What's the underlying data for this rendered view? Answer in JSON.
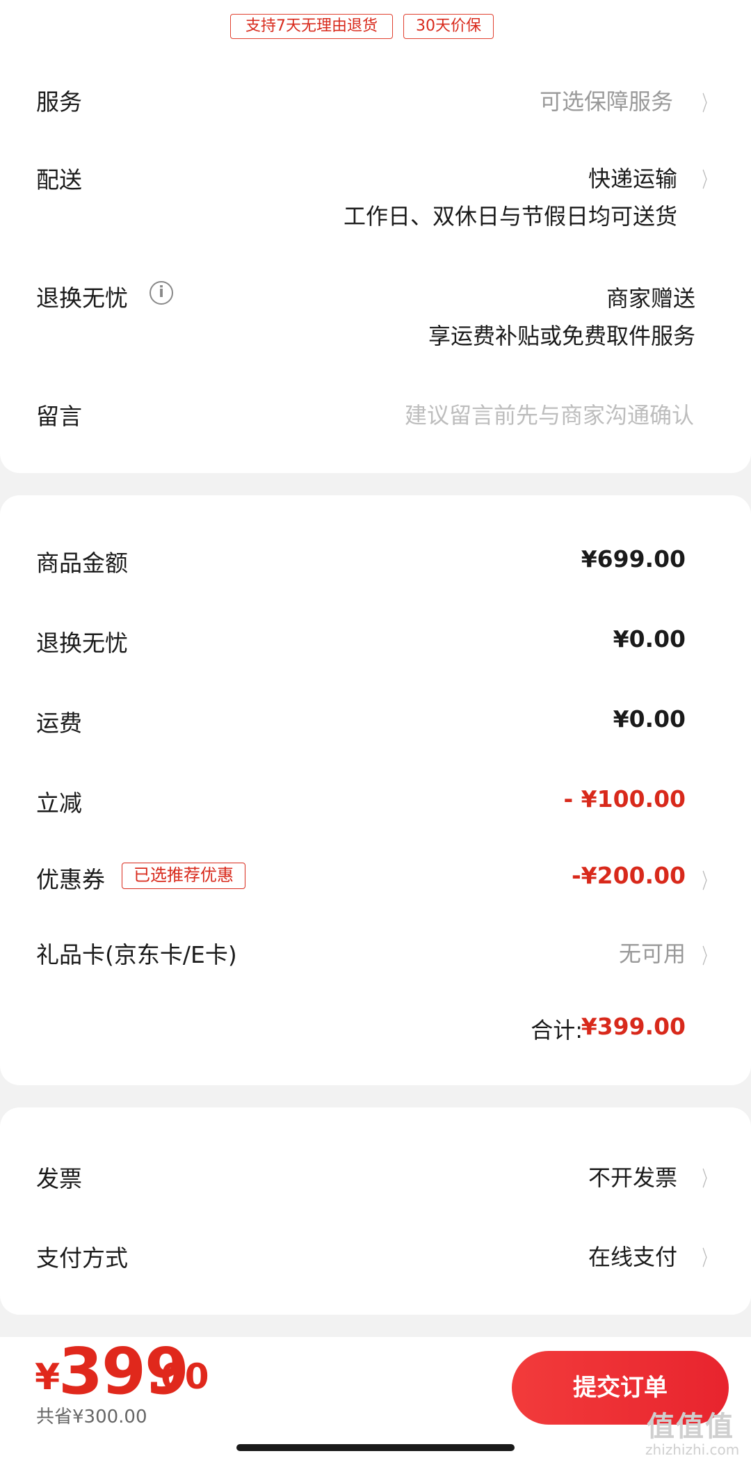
{
  "tags": {
    "return": "支持7天无理由退货",
    "price_protect": "30天价保"
  },
  "service": {
    "label": "服务",
    "value": "可选保障服务"
  },
  "delivery": {
    "label": "配送",
    "value": "快递运输",
    "sub": "工作日、双休日与节假日均可送货"
  },
  "return_worry": {
    "label": "退换无忧",
    "value": "商家赠送",
    "sub": "享运费补贴或免费取件服务"
  },
  "message": {
    "label": "留言",
    "placeholder": "建议留言前先与商家沟通确认"
  },
  "amounts": {
    "goods_label": "商品金额",
    "goods_value": "¥699.00",
    "return_label": "退换无忧",
    "return_value": "¥0.00",
    "shipping_label": "运费",
    "shipping_value": "¥0.00",
    "discount_label": "立减",
    "discount_value": "- ¥100.00",
    "coupon_label": "优惠券",
    "coupon_tag": "已选推荐优惠",
    "coupon_value": "-¥200.00",
    "giftcard_label": "礼品卡(京东卡/E卡)",
    "giftcard_value": "无可用",
    "total_label": "合计:",
    "total_value": "¥399.00"
  },
  "invoice": {
    "label": "发票",
    "value": "不开发票"
  },
  "payment": {
    "label": "支付方式",
    "value": "在线支付"
  },
  "bottom": {
    "currency": "¥",
    "price_int": "399",
    "price_dec": ".00",
    "saved": "共省¥300.00",
    "submit": "提交订单"
  },
  "watermark": {
    "main": "值值值",
    "sub": "zhizhizhi.com"
  },
  "colors": {
    "accent": "#e0281c",
    "button": "#ef3438"
  },
  "icons": {
    "chevron": "chevron-right-icon",
    "info": "info-icon"
  }
}
